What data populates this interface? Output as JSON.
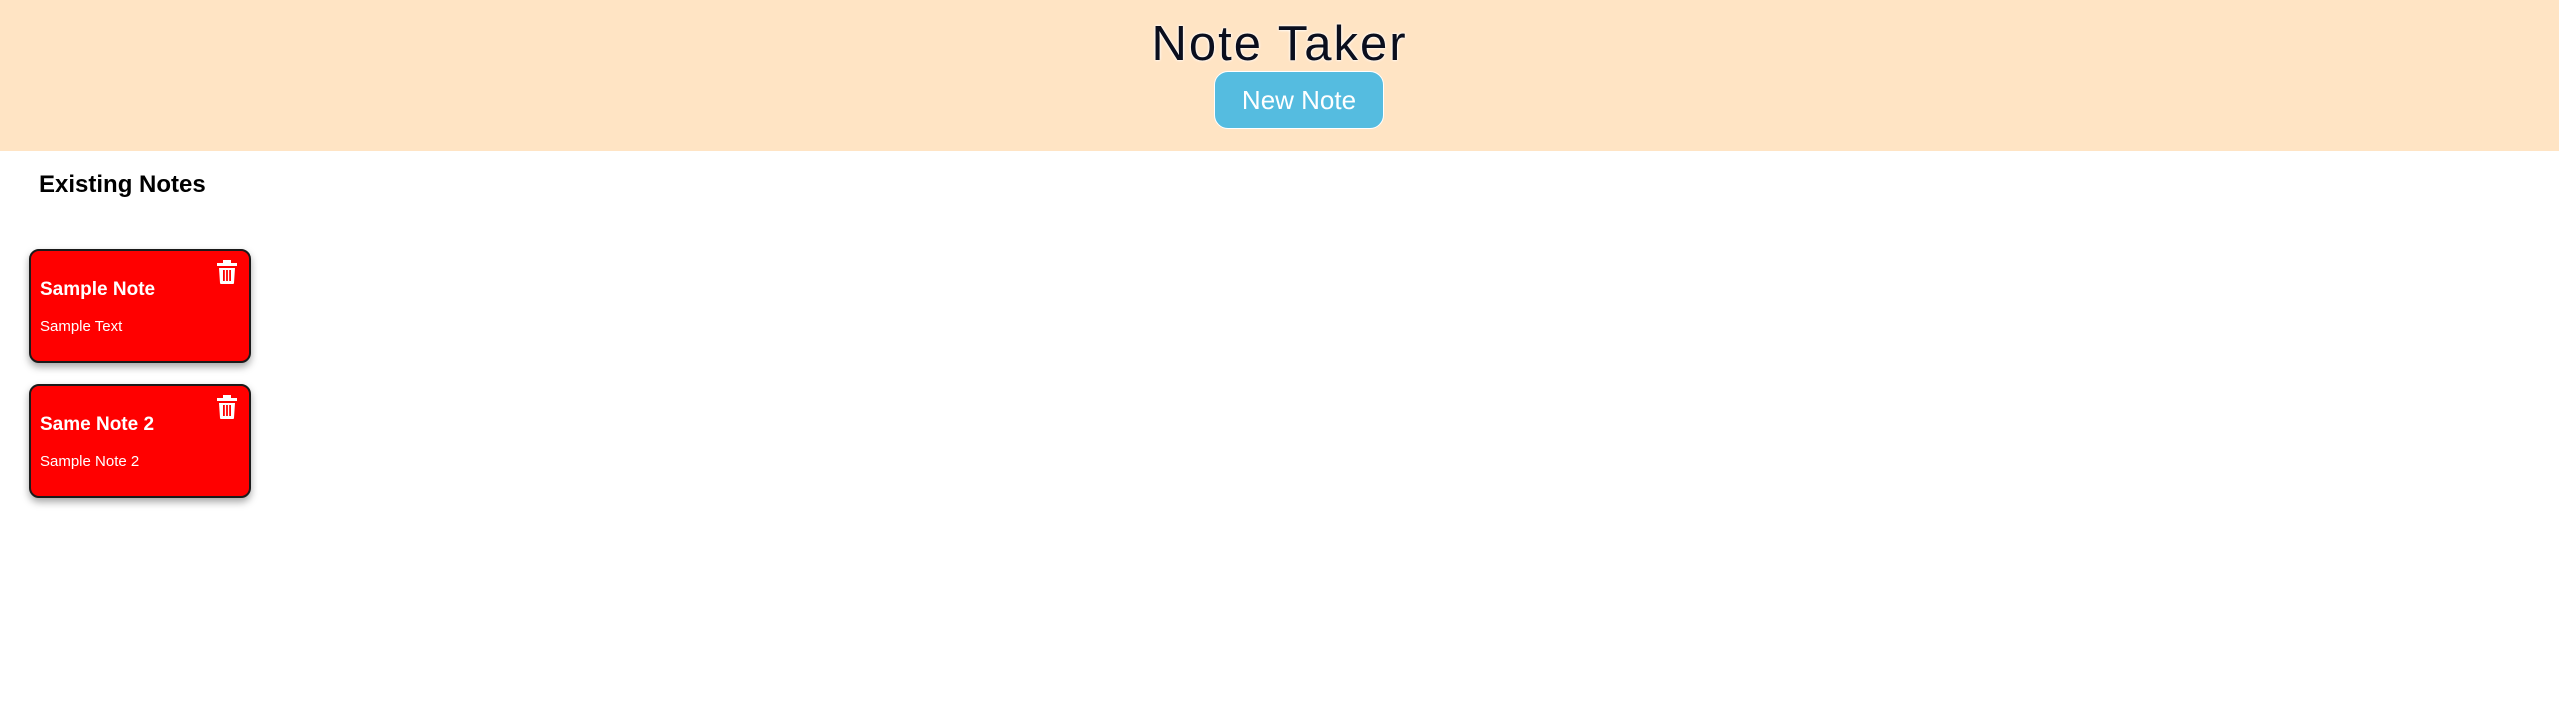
{
  "header": {
    "title": "Note Taker",
    "new_note_label": "New Note",
    "background_color": "#ffe4c4",
    "button_color": "#55bce0"
  },
  "notes_section": {
    "heading": "Existing Notes",
    "card_color": "#ff0000",
    "notes": [
      {
        "title": "Sample Note",
        "text": "Sample Text",
        "icon": "trash-icon"
      },
      {
        "title": "Same Note 2",
        "text": "Sample Note 2",
        "icon": "trash-icon"
      }
    ]
  }
}
